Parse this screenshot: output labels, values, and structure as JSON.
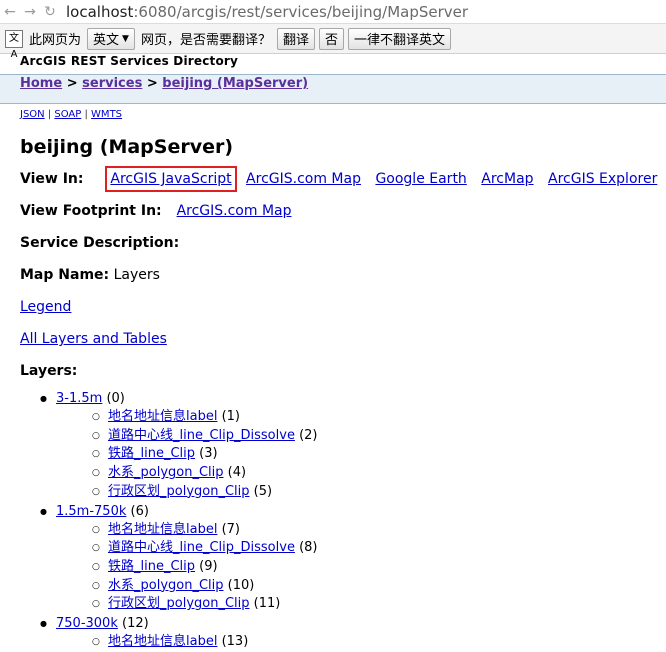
{
  "browser": {
    "url_host": "localhost",
    "url_rest": ":6080/arcgis/rest/services/beijing/MapServer",
    "translate": {
      "icon": "文A",
      "prompt": "此网页为",
      "lang": "英文",
      "question": "网页，是否需要翻译？",
      "translate_btn": "翻译",
      "no_btn": "否",
      "never_btn": "一律不翻译英文"
    }
  },
  "page": {
    "header": "ArcGIS REST Services Directory",
    "breadcrumb": {
      "home": "Home",
      "services": "services",
      "current": "beijing (MapServer)",
      "sep": ">"
    },
    "formats": [
      "JSON",
      "SOAP",
      "WMTS"
    ],
    "title": "beijing (MapServer)",
    "view_in_label": "View In:",
    "view_in_links": [
      "ArcGIS JavaScript",
      "ArcGIS.com Map",
      "Google Earth",
      "ArcMap",
      "ArcGIS Explorer"
    ],
    "footprint_label": "View Footprint In:",
    "footprint_link": "ArcGIS.com Map",
    "service_desc_label": "Service Description:",
    "map_name_label": "Map Name:",
    "map_name_value": "Layers",
    "legend": "Legend",
    "all_layers": "All Layers and Tables",
    "layers_label": "Layers:",
    "layers": [
      {
        "name": "3-1.5m",
        "id": "(0)",
        "children": [
          {
            "name": "地名地址信息label",
            "id": "(1)"
          },
          {
            "name": "道路中心线_line_Clip_Dissolve",
            "id": "(2)"
          },
          {
            "name": "铁路_line_Clip",
            "id": "(3)"
          },
          {
            "name": "水系_polygon_Clip",
            "id": "(4)"
          },
          {
            "name": "行政区划_polygon_Clip",
            "id": "(5)"
          }
        ]
      },
      {
        "name": "1.5m-750k",
        "id": "(6)",
        "children": [
          {
            "name": "地名地址信息label",
            "id": "(7)"
          },
          {
            "name": "道路中心线_line_Clip_Dissolve",
            "id": "(8)"
          },
          {
            "name": "铁路_line_Clip",
            "id": "(9)"
          },
          {
            "name": "水系_polygon_Clip",
            "id": "(10)"
          },
          {
            "name": "行政区划_polygon_Clip",
            "id": "(11)"
          }
        ]
      },
      {
        "name": "750-300k",
        "id": "(12)",
        "children": [
          {
            "name": "地名地址信息label",
            "id": "(13)"
          }
        ]
      }
    ]
  }
}
